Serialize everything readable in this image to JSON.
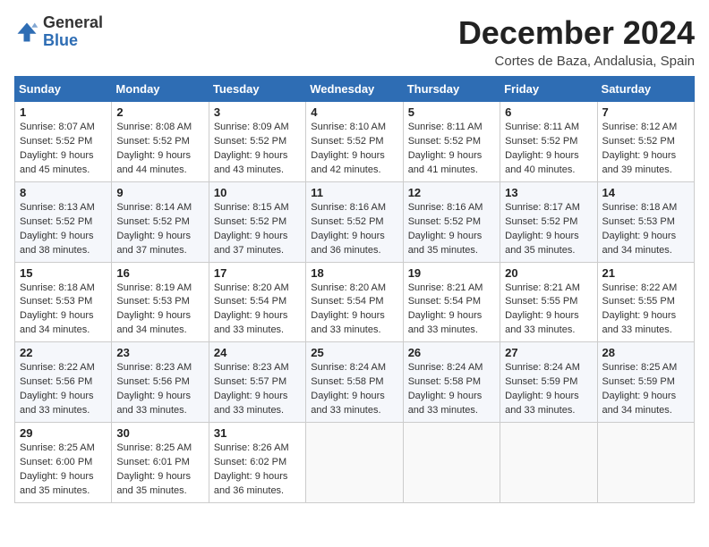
{
  "header": {
    "logo_general": "General",
    "logo_blue": "Blue",
    "month_title": "December 2024",
    "location": "Cortes de Baza, Andalusia, Spain"
  },
  "days_of_week": [
    "Sunday",
    "Monday",
    "Tuesday",
    "Wednesday",
    "Thursday",
    "Friday",
    "Saturday"
  ],
  "weeks": [
    [
      {
        "day": "1",
        "sunrise": "8:07 AM",
        "sunset": "5:52 PM",
        "daylight": "9 hours and 45 minutes."
      },
      {
        "day": "2",
        "sunrise": "8:08 AM",
        "sunset": "5:52 PM",
        "daylight": "9 hours and 44 minutes."
      },
      {
        "day": "3",
        "sunrise": "8:09 AM",
        "sunset": "5:52 PM",
        "daylight": "9 hours and 43 minutes."
      },
      {
        "day": "4",
        "sunrise": "8:10 AM",
        "sunset": "5:52 PM",
        "daylight": "9 hours and 42 minutes."
      },
      {
        "day": "5",
        "sunrise": "8:11 AM",
        "sunset": "5:52 PM",
        "daylight": "9 hours and 41 minutes."
      },
      {
        "day": "6",
        "sunrise": "8:11 AM",
        "sunset": "5:52 PM",
        "daylight": "9 hours and 40 minutes."
      },
      {
        "day": "7",
        "sunrise": "8:12 AM",
        "sunset": "5:52 PM",
        "daylight": "9 hours and 39 minutes."
      }
    ],
    [
      {
        "day": "8",
        "sunrise": "8:13 AM",
        "sunset": "5:52 PM",
        "daylight": "9 hours and 38 minutes."
      },
      {
        "day": "9",
        "sunrise": "8:14 AM",
        "sunset": "5:52 PM",
        "daylight": "9 hours and 37 minutes."
      },
      {
        "day": "10",
        "sunrise": "8:15 AM",
        "sunset": "5:52 PM",
        "daylight": "9 hours and 37 minutes."
      },
      {
        "day": "11",
        "sunrise": "8:16 AM",
        "sunset": "5:52 PM",
        "daylight": "9 hours and 36 minutes."
      },
      {
        "day": "12",
        "sunrise": "8:16 AM",
        "sunset": "5:52 PM",
        "daylight": "9 hours and 35 minutes."
      },
      {
        "day": "13",
        "sunrise": "8:17 AM",
        "sunset": "5:52 PM",
        "daylight": "9 hours and 35 minutes."
      },
      {
        "day": "14",
        "sunrise": "8:18 AM",
        "sunset": "5:53 PM",
        "daylight": "9 hours and 34 minutes."
      }
    ],
    [
      {
        "day": "15",
        "sunrise": "8:18 AM",
        "sunset": "5:53 PM",
        "daylight": "9 hours and 34 minutes."
      },
      {
        "day": "16",
        "sunrise": "8:19 AM",
        "sunset": "5:53 PM",
        "daylight": "9 hours and 34 minutes."
      },
      {
        "day": "17",
        "sunrise": "8:20 AM",
        "sunset": "5:54 PM",
        "daylight": "9 hours and 33 minutes."
      },
      {
        "day": "18",
        "sunrise": "8:20 AM",
        "sunset": "5:54 PM",
        "daylight": "9 hours and 33 minutes."
      },
      {
        "day": "19",
        "sunrise": "8:21 AM",
        "sunset": "5:54 PM",
        "daylight": "9 hours and 33 minutes."
      },
      {
        "day": "20",
        "sunrise": "8:21 AM",
        "sunset": "5:55 PM",
        "daylight": "9 hours and 33 minutes."
      },
      {
        "day": "21",
        "sunrise": "8:22 AM",
        "sunset": "5:55 PM",
        "daylight": "9 hours and 33 minutes."
      }
    ],
    [
      {
        "day": "22",
        "sunrise": "8:22 AM",
        "sunset": "5:56 PM",
        "daylight": "9 hours and 33 minutes."
      },
      {
        "day": "23",
        "sunrise": "8:23 AM",
        "sunset": "5:56 PM",
        "daylight": "9 hours and 33 minutes."
      },
      {
        "day": "24",
        "sunrise": "8:23 AM",
        "sunset": "5:57 PM",
        "daylight": "9 hours and 33 minutes."
      },
      {
        "day": "25",
        "sunrise": "8:24 AM",
        "sunset": "5:58 PM",
        "daylight": "9 hours and 33 minutes."
      },
      {
        "day": "26",
        "sunrise": "8:24 AM",
        "sunset": "5:58 PM",
        "daylight": "9 hours and 33 minutes."
      },
      {
        "day": "27",
        "sunrise": "8:24 AM",
        "sunset": "5:59 PM",
        "daylight": "9 hours and 33 minutes."
      },
      {
        "day": "28",
        "sunrise": "8:25 AM",
        "sunset": "5:59 PM",
        "daylight": "9 hours and 34 minutes."
      }
    ],
    [
      {
        "day": "29",
        "sunrise": "8:25 AM",
        "sunset": "6:00 PM",
        "daylight": "9 hours and 35 minutes."
      },
      {
        "day": "30",
        "sunrise": "8:25 AM",
        "sunset": "6:01 PM",
        "daylight": "9 hours and 35 minutes."
      },
      {
        "day": "31",
        "sunrise": "8:26 AM",
        "sunset": "6:02 PM",
        "daylight": "9 hours and 36 minutes."
      },
      null,
      null,
      null,
      null
    ]
  ]
}
